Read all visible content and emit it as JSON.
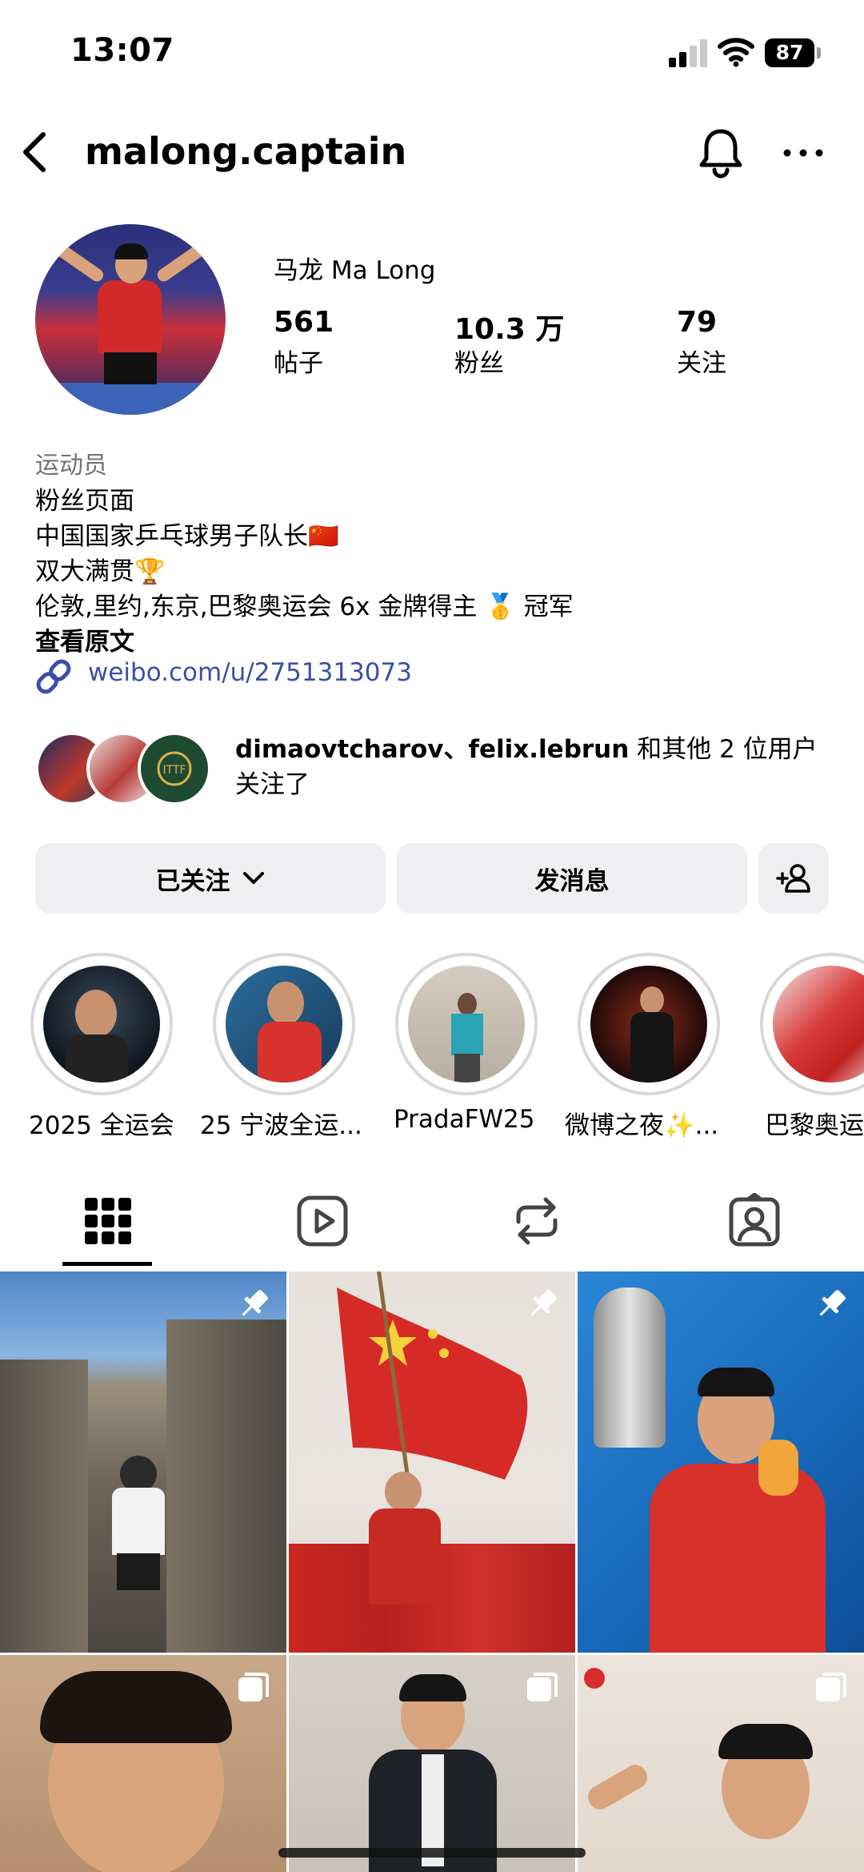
{
  "status_bar": {
    "time": "13:07",
    "battery": "87"
  },
  "header": {
    "username": "malong.captain"
  },
  "profile": {
    "display_name": "马龙 Ma Long",
    "stats": [
      {
        "value": "561",
        "label": "帖子"
      },
      {
        "value": "10.3 万",
        "label": "粉丝"
      },
      {
        "value": "79",
        "label": "关注"
      }
    ],
    "category": "运动员",
    "bio": [
      "粉丝页面",
      "中国国家乒乓球男子队长🇨🇳",
      "双大满贯🏆",
      "伦敦,里约,东京,巴黎奥运会 6x 金牌得主 🥇 冠军"
    ],
    "see_original": "查看原文",
    "link": "weibo.com/u/2751313073",
    "mutual": {
      "names": "dimaovtcharov、felix.lebrun",
      "suffix": " 和其他 2 位用户关注了"
    }
  },
  "buttons": {
    "following": "已关注",
    "message": "发消息"
  },
  "highlights": [
    {
      "label": "2025 全运会"
    },
    {
      "label": "25 宁波全运..."
    },
    {
      "label": "PradaFW25"
    },
    {
      "label": "微博之夜✨..."
    },
    {
      "label": "巴黎奥运"
    }
  ],
  "tabs": [
    "grid-icon",
    "reels-icon",
    "reposts-icon",
    "tagged-icon"
  ],
  "grid": [
    {
      "badge": "pin-icon"
    },
    {
      "badge": "pin-icon"
    },
    {
      "badge": "pin-icon"
    },
    {
      "badge": "multi-icon"
    },
    {
      "badge": "multi-icon"
    },
    {
      "badge": "multi-icon"
    }
  ]
}
